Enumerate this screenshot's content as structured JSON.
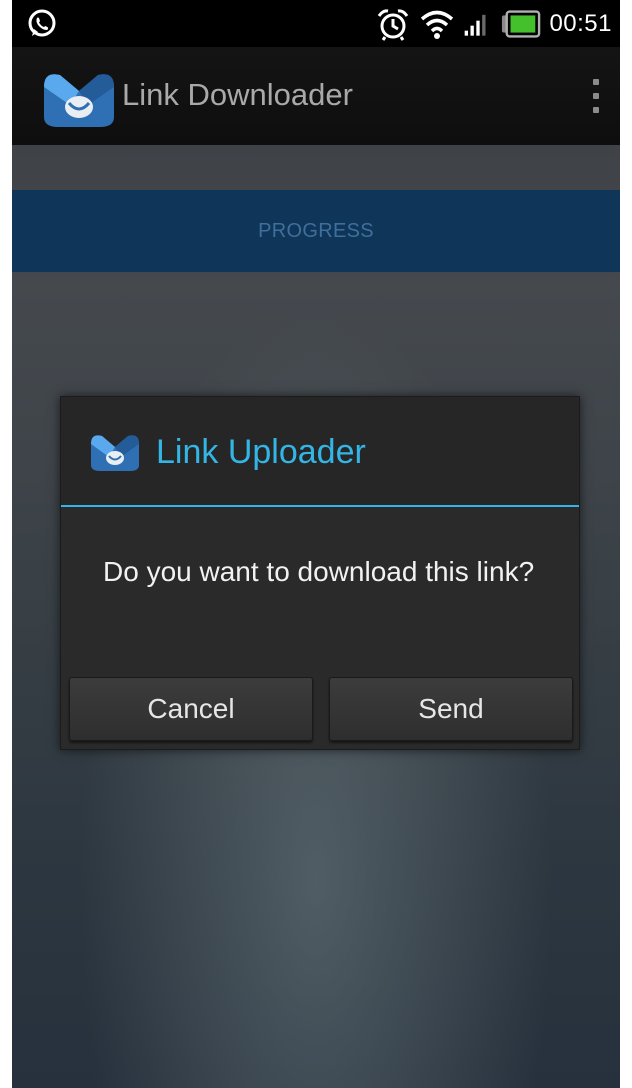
{
  "status_bar": {
    "time": "00:51",
    "left_icon": "whatsapp-icon",
    "right_icons": [
      "alarm-icon",
      "wifi-icon",
      "signal-icon",
      "battery-icon"
    ]
  },
  "action_bar": {
    "title": "Link Downloader",
    "logo_icon": "app-logo-icon",
    "menu_icon": "overflow-menu-icon"
  },
  "tab": {
    "label": "PROGRESS"
  },
  "dialog": {
    "title": "Link Uploader",
    "icon": "app-logo-icon",
    "message": "Do you want to download this link?",
    "cancel_label": "Cancel",
    "send_label": "Send"
  },
  "colors": {
    "accent": "#33b5e5",
    "tab_background": "#0f3558",
    "tab_text": "#3f6f9c",
    "dialog_background": "#2a2a2a"
  }
}
